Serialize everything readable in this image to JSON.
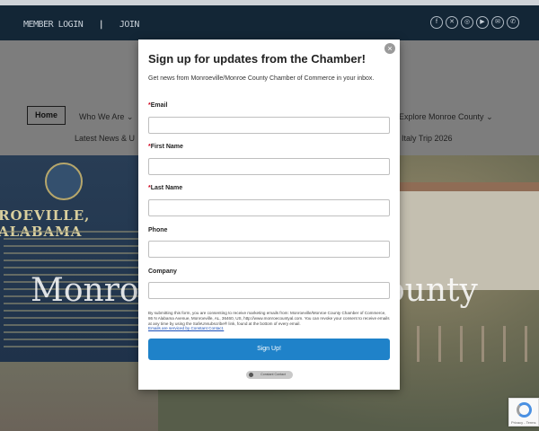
{
  "topbar": {
    "member_login": "MEMBER LOGIN",
    "separator": "|",
    "join": "JOIN"
  },
  "social_icons": [
    "facebook-icon",
    "x-icon",
    "instagram-icon",
    "youtube-icon",
    "email-icon",
    "whatsapp-icon"
  ],
  "nav": {
    "home": "Home",
    "who_we_are": "Who We Are",
    "explore": "Explore Monroe County",
    "latest_news": "Latest News & U",
    "italy_trip": "Italy Trip 2026"
  },
  "hero": {
    "sign_text": "ROEVILLE, ALABAMA",
    "title_left": "Monro",
    "title_right": "ounty"
  },
  "modal": {
    "title": "Sign up for updates from the Chamber!",
    "description": "Get news from Monroeville/Monroe County Chamber of Commerce in your inbox.",
    "required_mark": "*",
    "fields": {
      "email": "Email",
      "first_name": "First Name",
      "last_name": "Last Name",
      "phone": "Phone",
      "company": "Company"
    },
    "legal": "By submitting this form, you are consenting to receive marketing emails from: Monroeville/Monroe County Chamber of Commerce, 86 N Alabama Avenue, Monroeville, AL, 36460, US, http://www.monroecountyal.com. You can revoke your consent to receive emails at any time by using the SafeUnsubscribe® link, found at the bottom of every email.",
    "legal_link": "Emails are serviced by Constant Contact.",
    "signup_button": "Sign Up!",
    "badge": "Constant Contact",
    "close_symbol": "×"
  },
  "recaptcha": {
    "links": "Privacy - Terms"
  },
  "colors": {
    "topbar": "#132636",
    "button": "#1f82c9",
    "required": "#d0021b"
  }
}
